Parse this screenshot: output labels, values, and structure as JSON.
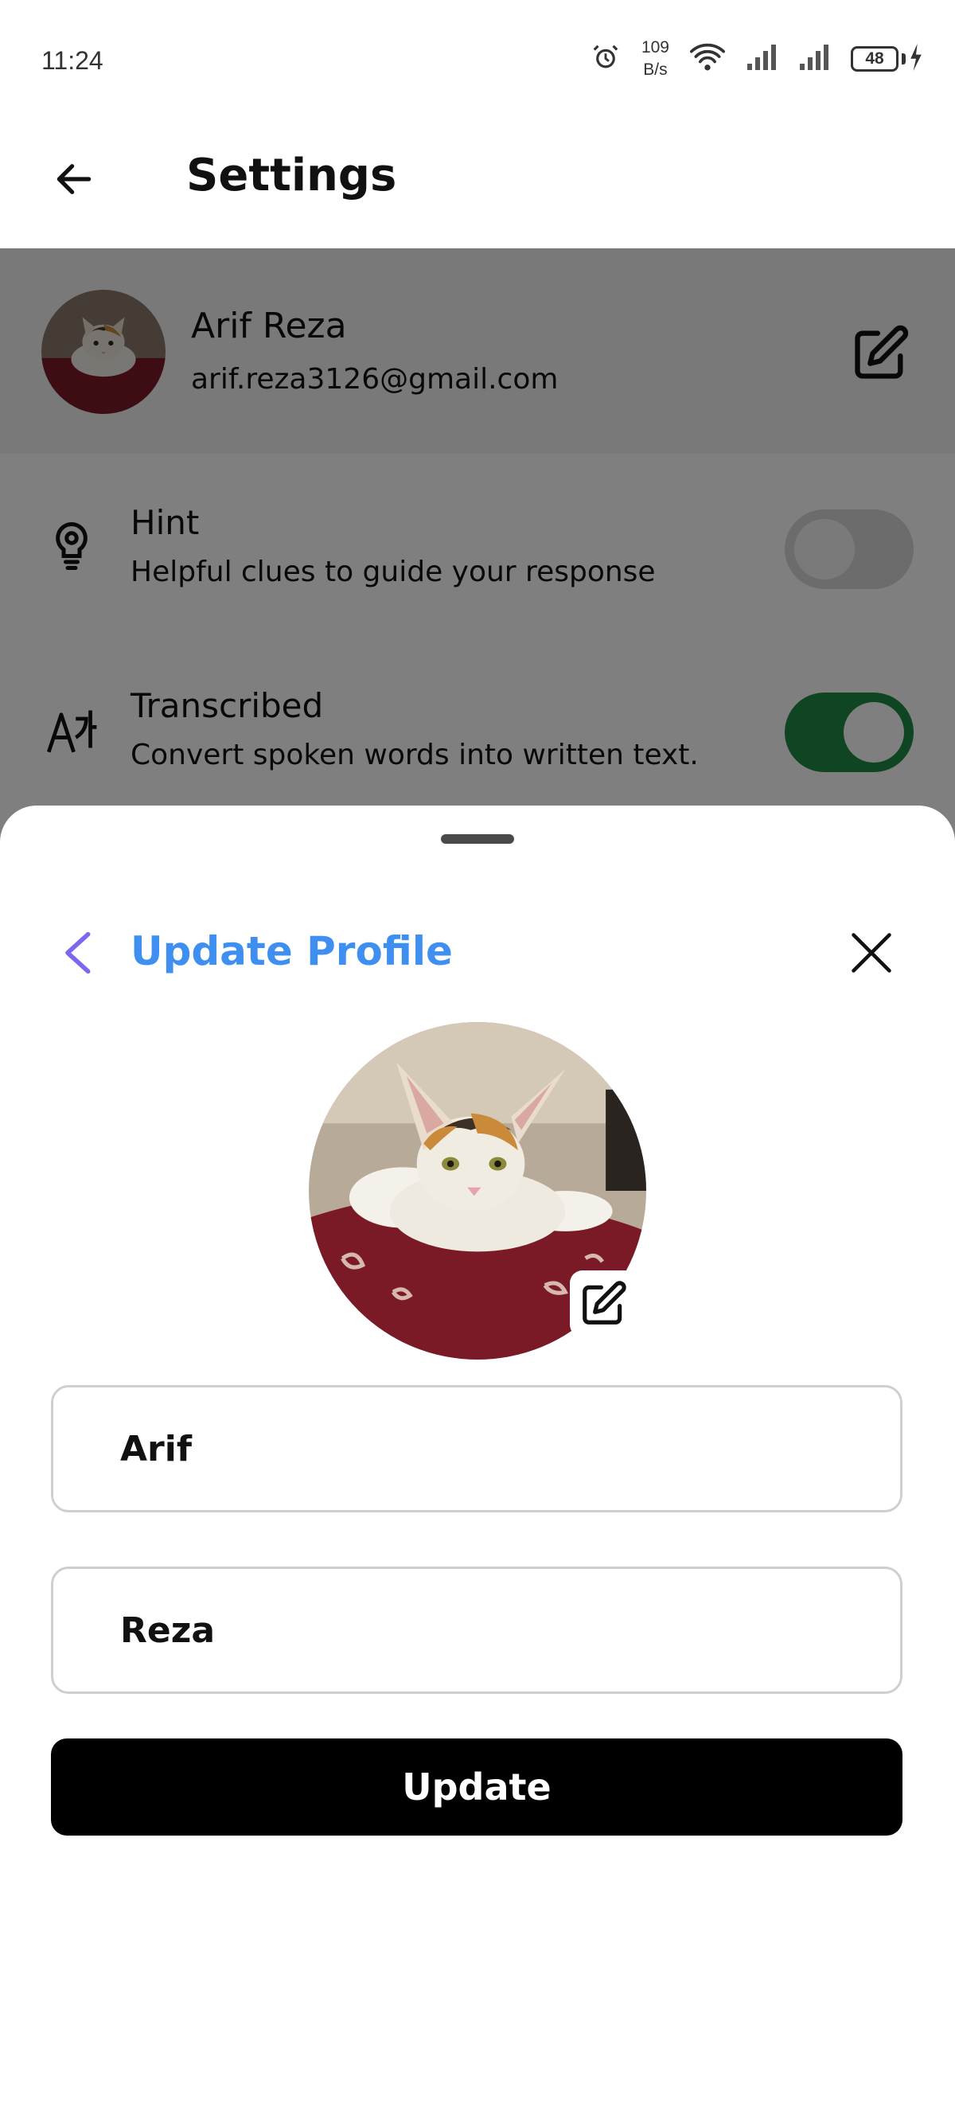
{
  "status_bar": {
    "time": "11:24",
    "net_speed_value": "109",
    "net_speed_unit": "B/s",
    "battery": "48",
    "icons": [
      "alarm-icon",
      "wifi-icon",
      "signal-icon",
      "signal-icon",
      "battery-icon",
      "charging-icon"
    ]
  },
  "header": {
    "title": "Settings",
    "back_icon": "arrow-left-icon"
  },
  "profile": {
    "name": "Arif Reza",
    "email": "arif.reza3126@gmail.com",
    "edit_icon": "edit-icon"
  },
  "settings": [
    {
      "title": "Hint",
      "description": "Helpful clues to guide your response",
      "icon": "lightbulb-icon",
      "enabled": false
    },
    {
      "title": "Transcribed",
      "description": "Convert spoken words into written text.",
      "icon": "translate-icon",
      "enabled": true
    }
  ],
  "sheet": {
    "title": "Update Profile",
    "first_name": "Arif",
    "last_name": "Reza",
    "update_label": "Update"
  },
  "colors": {
    "accent": "#3f8ff0",
    "back_arrow": "#7b68ee",
    "toggle_on": "#1f8a45",
    "button": "#000000"
  }
}
